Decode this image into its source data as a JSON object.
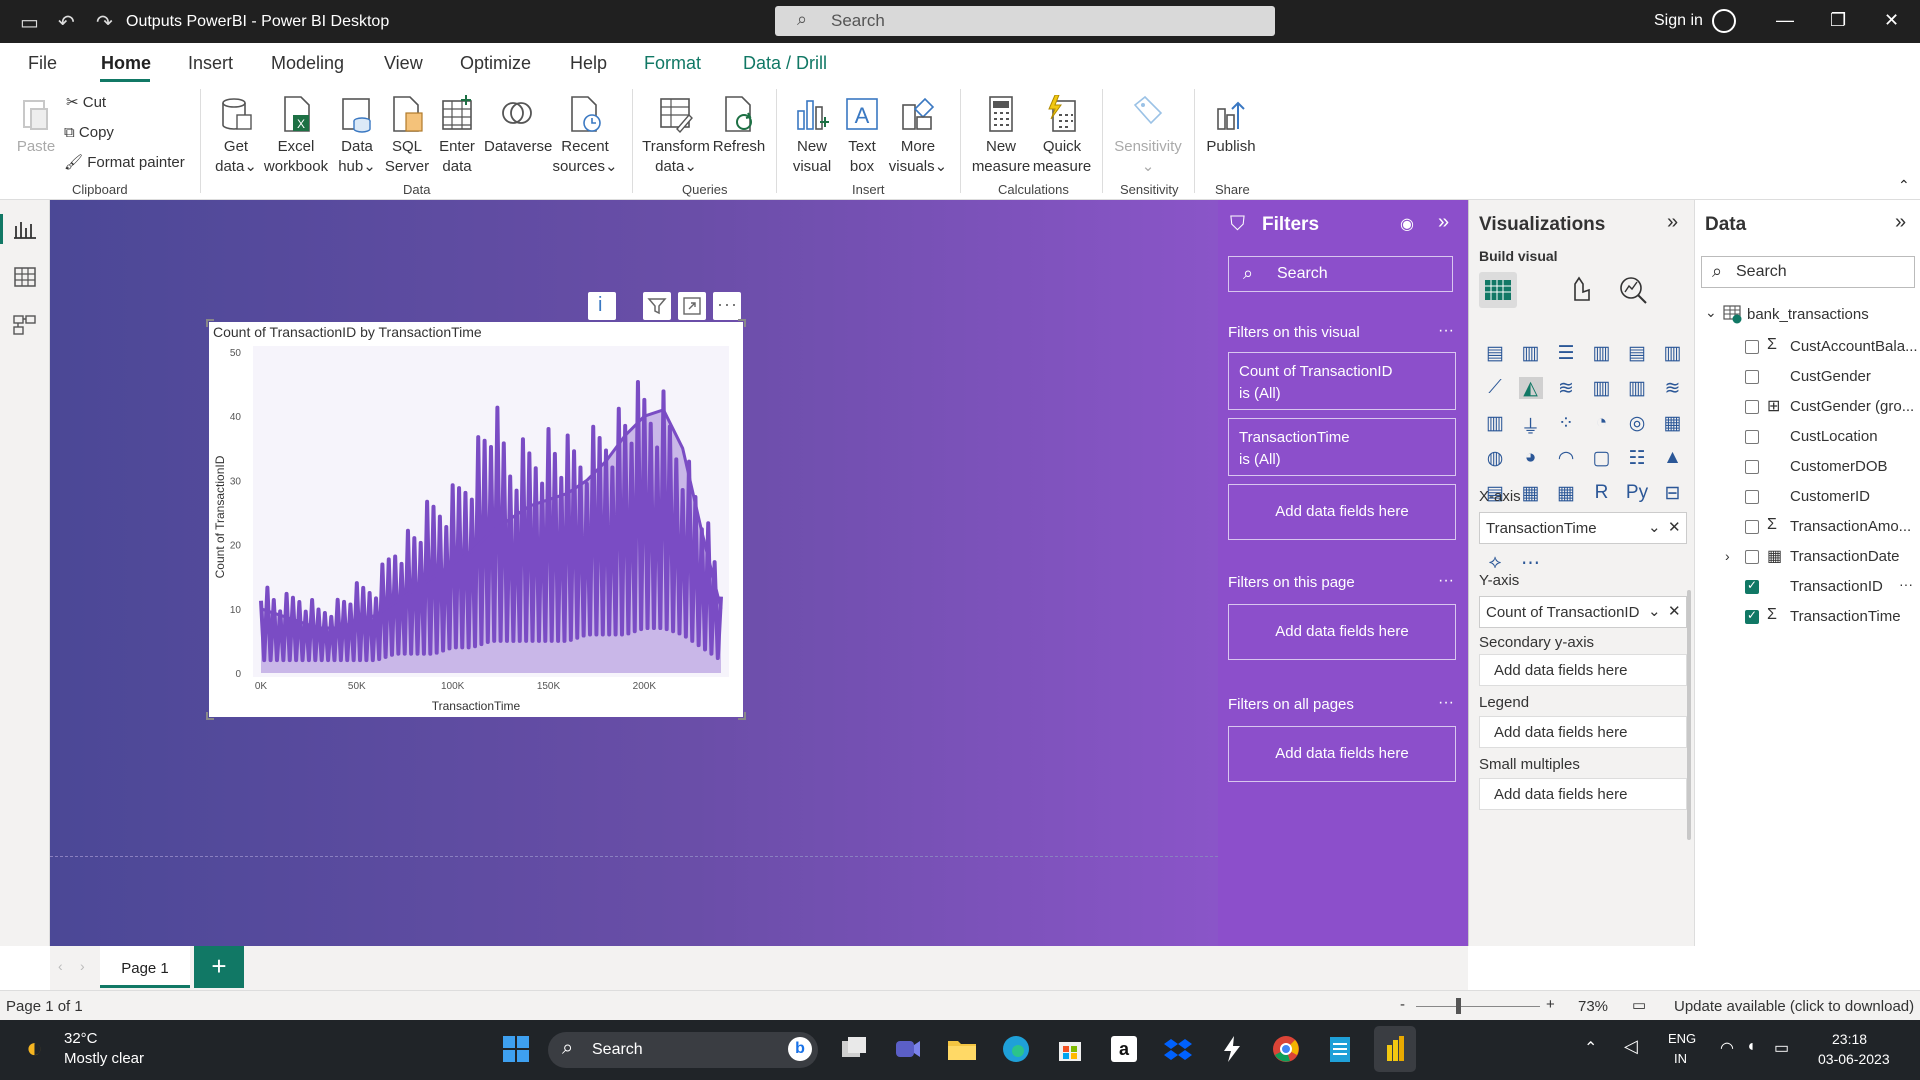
{
  "app": {
    "title": "Outputs PowerBI - Power BI Desktop",
    "search_placeholder": "Search",
    "sign_in": "Sign in"
  },
  "menu": {
    "tabs": [
      "File",
      "Home",
      "Insert",
      "Modeling",
      "View",
      "Optimize",
      "Help",
      "Format",
      "Data / Drill"
    ]
  },
  "ribbon": {
    "paste": "Paste",
    "cut": "Cut",
    "copy": "Copy",
    "format_painter": "Format painter",
    "clipboard_group": "Clipboard",
    "get_data": [
      "Get",
      "data"
    ],
    "excel": [
      "Excel",
      "workbook"
    ],
    "data_hub": [
      "Data",
      "hub"
    ],
    "sql": [
      "SQL",
      "Server"
    ],
    "enter_data": [
      "Enter",
      "data"
    ],
    "dataverse": "Dataverse",
    "recent": [
      "Recent",
      "sources"
    ],
    "data_group": "Data",
    "transform": [
      "Transform",
      "data"
    ],
    "refresh": "Refresh",
    "queries_group": "Queries",
    "new_visual": [
      "New",
      "visual"
    ],
    "text_box": [
      "Text",
      "box"
    ],
    "more_visuals": [
      "More",
      "visuals"
    ],
    "insert_group": "Insert",
    "new_measure": [
      "New",
      "measure"
    ],
    "quick_measure": [
      "Quick",
      "measure"
    ],
    "calc_group": "Calculations",
    "sensitivity": "Sensitivity",
    "sensitivity_group": "Sensitivity",
    "publish": "Publish",
    "share_group": "Share"
  },
  "visual": {
    "title": "Count of TransactionID by TransactionTime"
  },
  "chart_data": {
    "type": "area",
    "title": "Count of TransactionID by TransactionTime",
    "xlabel": "TransactionTime",
    "ylabel": "Count of TransactionID",
    "xlim": [
      0,
      240000
    ],
    "ylim": [
      0,
      50
    ],
    "x_ticks": [
      "0K",
      "50K",
      "100K",
      "150K",
      "200K"
    ],
    "y_ticks": [
      "0",
      "10",
      "20",
      "30",
      "40",
      "50"
    ],
    "x": [
      0,
      10000,
      20000,
      30000,
      40000,
      50000,
      60000,
      70000,
      80000,
      90000,
      100000,
      110000,
      120000,
      130000,
      140000,
      150000,
      160000,
      170000,
      180000,
      190000,
      200000,
      210000,
      220000,
      230000,
      240000
    ],
    "values": [
      10,
      9,
      8,
      7,
      7,
      8,
      9,
      11,
      13,
      15,
      17,
      19,
      22,
      24,
      26,
      27,
      28,
      30,
      33,
      37,
      40,
      41,
      35,
      22,
      10
    ],
    "peaks": [
      15,
      12,
      13,
      11,
      12,
      14,
      15,
      22,
      24,
      28,
      30,
      36,
      44,
      36,
      38,
      40,
      37,
      38,
      42,
      44,
      46,
      45,
      38,
      28,
      14
    ],
    "troughs": [
      2,
      2,
      2,
      2,
      2,
      2,
      2,
      3,
      3,
      3,
      4,
      4,
      5,
      5,
      5,
      5,
      5,
      6,
      6,
      6,
      7,
      7,
      6,
      4,
      2
    ],
    "colors": {
      "fill": "#c9b7e8",
      "line": "#7a4cc4"
    },
    "grid": false
  },
  "filters": {
    "title": "Filters",
    "search": "Search",
    "on_visual": "Filters on this visual",
    "card1": [
      "Count of TransactionID",
      "is (All)"
    ],
    "card2": [
      "TransactionTime",
      "is (All)"
    ],
    "add": "Add data fields here",
    "on_page": "Filters on this page",
    "on_all": "Filters on all pages"
  },
  "viz": {
    "title": "Visualizations",
    "build": "Build visual",
    "xaxis": "X-axis",
    "xfield": "TransactionTime",
    "yaxis": "Y-axis",
    "yfield": "Count of TransactionID",
    "secondary": "Secondary y-axis",
    "legend": "Legend",
    "small_multiples": "Small multiples",
    "add": "Add data fields here"
  },
  "datapane": {
    "title": "Data",
    "search": "Search",
    "table": "bank_transactions",
    "fields": [
      {
        "name": "CustAccountBala...",
        "checked": false,
        "sigma": true
      },
      {
        "name": "CustGender",
        "checked": false,
        "sigma": false
      },
      {
        "name": "CustGender (gro...",
        "checked": false,
        "sigma": false
      },
      {
        "name": "CustLocation",
        "checked": false,
        "sigma": false
      },
      {
        "name": "CustomerDOB",
        "checked": false,
        "sigma": false
      },
      {
        "name": "CustomerID",
        "checked": false,
        "sigma": false
      },
      {
        "name": "TransactionAmo...",
        "checked": false,
        "sigma": true
      },
      {
        "name": "TransactionDate",
        "checked": false,
        "sigma": false
      },
      {
        "name": "TransactionID",
        "checked": true,
        "sigma": false
      },
      {
        "name": "TransactionTime",
        "checked": true,
        "sigma": true
      }
    ]
  },
  "pages": {
    "tab": "Page 1",
    "status": "Page 1 of 1"
  },
  "status": {
    "zoom": "73%",
    "update": "Update available (click to download)"
  },
  "taskbar": {
    "temp": "32°C",
    "weather": "Mostly clear",
    "search": "Search",
    "lang1": "ENG",
    "lang2": "IN",
    "time": "23:18",
    "date": "03-06-2023"
  }
}
